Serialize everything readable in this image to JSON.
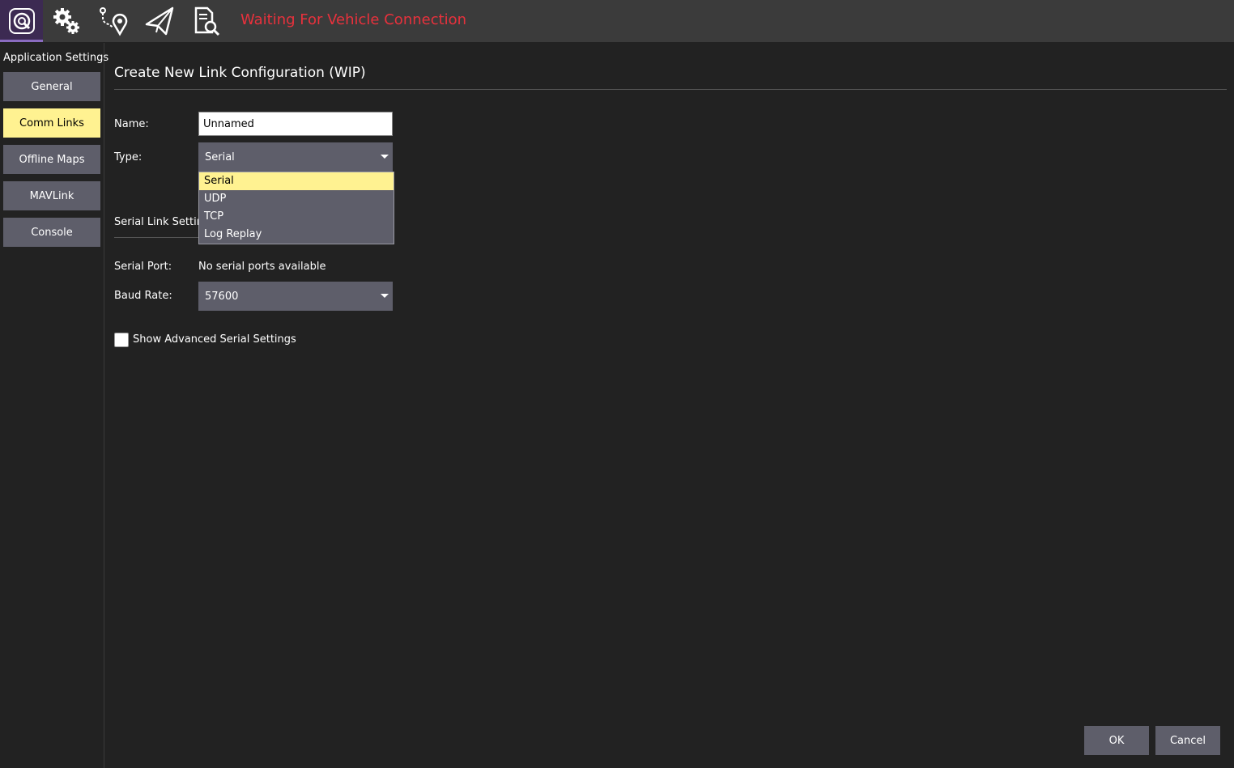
{
  "toolbar": {
    "status_text": "Waiting For Vehicle Connection",
    "icons": [
      "qgc-logo-icon",
      "gears-icon",
      "plan-route-icon",
      "paper-plane-icon",
      "analyze-document-icon"
    ]
  },
  "sidebar": {
    "title": "Application Settings",
    "items": [
      {
        "label": "General",
        "active": false
      },
      {
        "label": "Comm Links",
        "active": true
      },
      {
        "label": "Offline Maps",
        "active": false
      },
      {
        "label": "MAVLink",
        "active": false
      },
      {
        "label": "Console",
        "active": false
      }
    ]
  },
  "form": {
    "title": "Create New Link Configuration (WIP)",
    "name_label": "Name:",
    "name_value": "Unnamed",
    "type_label": "Type:",
    "type_value": "Serial",
    "type_options": [
      "Serial",
      "UDP",
      "TCP",
      "Log Replay"
    ],
    "section_label": "Serial Link Settings",
    "serial_port_label": "Serial Port:",
    "serial_port_value": "No serial ports available",
    "baud_rate_label": "Baud Rate:",
    "baud_rate_value": "57600",
    "advanced_label": "Show Advanced Serial Settings",
    "advanced_checked": false
  },
  "buttons": {
    "ok": "OK",
    "cancel": "Cancel"
  },
  "colors": {
    "background": "#222222",
    "toolbar": "#3b3b3b",
    "button": "#5e5e6a",
    "active": "#fff291",
    "status": "#e8313c",
    "logo_bg": "#3c2a52"
  }
}
